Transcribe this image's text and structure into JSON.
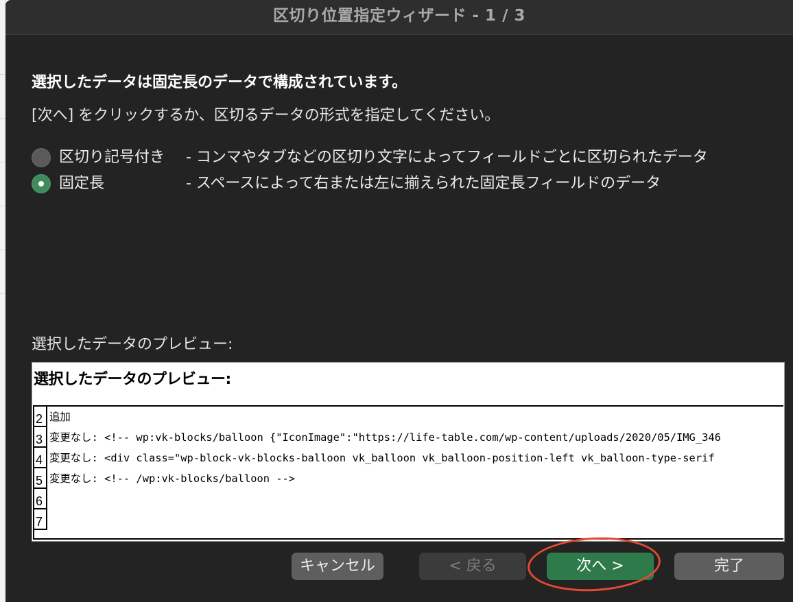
{
  "dialog": {
    "title": "区切り位置指定ウィザード - 1 / 3",
    "heading": "選択したデータは固定長のデータで構成されています。",
    "instruction": "[次へ] をクリックするか、区切るデータの形式を指定してください。",
    "options": [
      {
        "label": "区切り記号付き",
        "description": "- コンマやタブなどの区切り文字によってフィールドごとに区切られたデータ",
        "selected": false
      },
      {
        "label": "固定長",
        "description": "- スペースによって右または左に揃えられた固定長フィールドのデータ",
        "selected": true
      }
    ],
    "preview_label": "選択したデータのプレビュー:",
    "preview": {
      "heading": "選択したデータのプレビュー:",
      "rows": [
        {
          "num": "2",
          "text": "追加"
        },
        {
          "num": "3",
          "text": "変更なし: <!-- wp:vk-blocks/balloon {\"IconImage\":\"https://life-table.com/wp-content/uploads/2020/05/IMG_346"
        },
        {
          "num": "4",
          "text": "変更なし: <div class=\"wp-block-vk-blocks-balloon vk_balloon vk_balloon-position-left vk_balloon-type-serif"
        },
        {
          "num": "5",
          "text": "変更なし: <!-- /wp:vk-blocks/balloon -->"
        },
        {
          "num": "6",
          "text": ""
        },
        {
          "num": "7",
          "text": ""
        }
      ]
    },
    "buttons": {
      "cancel": "キャンセル",
      "back": "< 戻る",
      "next": "次へ >",
      "finish": "完了"
    }
  },
  "colors": {
    "dialog_background": "#232323",
    "primary_button": "#2f7a4a",
    "radio_selected": "#3f8b5e",
    "annotation_circle": "#e34a2f"
  }
}
